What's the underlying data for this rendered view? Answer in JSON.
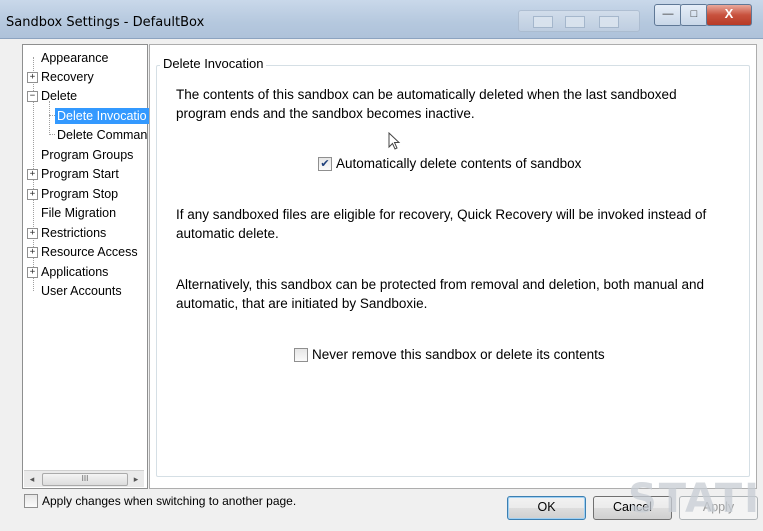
{
  "window": {
    "title": "Sandbox Settings - DefaultBox"
  },
  "window_controls": {
    "min": "—",
    "max": "□",
    "close": "X"
  },
  "tree": {
    "items": [
      {
        "label": "Appearance",
        "expander": ""
      },
      {
        "label": "Recovery",
        "expander": "+"
      },
      {
        "label": "Delete",
        "expander": "−"
      },
      {
        "label": "Delete Invocatio",
        "expander": "",
        "selected": true
      },
      {
        "label": "Delete Comman",
        "expander": ""
      },
      {
        "label": "Program Groups",
        "expander": ""
      },
      {
        "label": "Program Start",
        "expander": "+"
      },
      {
        "label": "Program Stop",
        "expander": "+"
      },
      {
        "label": "File Migration",
        "expander": ""
      },
      {
        "label": "Restrictions",
        "expander": "+"
      },
      {
        "label": "Resource Access",
        "expander": "+"
      },
      {
        "label": "Applications",
        "expander": "+"
      },
      {
        "label": "User Accounts",
        "expander": ""
      }
    ],
    "scroll_left": "◂",
    "scroll_right": "▸",
    "scroll_grip": "III"
  },
  "content": {
    "group_title": "Delete Invocation",
    "paragraph1": "The contents of this sandbox can be automatically deleted when the last sandboxed program ends and the sandbox becomes inactive.",
    "auto_delete": {
      "label": "Automatically delete contents of sandbox",
      "checked": true,
      "mark": "✔"
    },
    "paragraph2": "If any sandboxed files are eligible for recovery, Quick Recovery will be invoked instead of automatic delete.",
    "paragraph3": "Alternatively, this sandbox can be protected from removal and deletion, both manual and automatic, that are initiated by Sandboxie.",
    "never_remove": {
      "label": "Never remove this sandbox or delete its contents",
      "checked": false,
      "mark": ""
    }
  },
  "footer": {
    "apply_on_switch": {
      "label": "Apply changes when switching to another page.",
      "checked": false
    },
    "ok_label": "OK",
    "cancel_label": "Cancel",
    "apply_label": "Apply"
  },
  "watermark": "STATI",
  "icons": {
    "cursor": "arrow-cursor-icon"
  }
}
